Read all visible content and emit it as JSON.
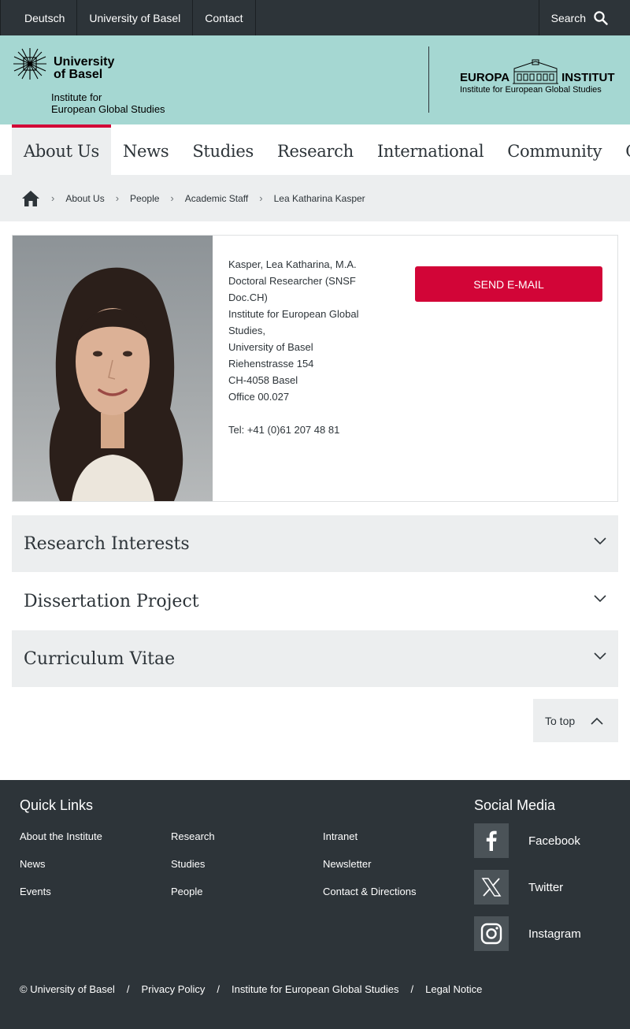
{
  "topbar": {
    "links": [
      "Deutsch",
      "University of Basel",
      "Contact"
    ],
    "search_label": "Search"
  },
  "header": {
    "uni_line1": "University",
    "uni_line2": "of Basel",
    "institute_line1": "Institute for",
    "institute_line2": "European Global Studies",
    "europa_left": "EUROPA",
    "europa_right": "INSTITUT",
    "europa_sub": "Institute for European Global Studies"
  },
  "nav": {
    "items": [
      "About Us",
      "News",
      "Studies",
      "Research",
      "International",
      "Community",
      "Co"
    ],
    "active": "About Us"
  },
  "breadcrumb": [
    "About Us",
    "People",
    "Academic Staff",
    "Lea Katharina Kasper"
  ],
  "profile": {
    "lines": [
      "Kasper, Lea Katharina, M.A.",
      "Doctoral Researcher (SNSF Doc.CH)",
      "Institute for European Global Studies,",
      "University of Basel",
      "Riehenstrasse 154",
      "CH-4058 Basel",
      "Office 00.027"
    ],
    "tel": "Tel: +41 (0)61 207 48 81",
    "email_button": "SEND E-MAIL"
  },
  "accordions": [
    "Research Interests",
    "Dissertation Project",
    "Curriculum Vitae"
  ],
  "to_top": "To top",
  "footer": {
    "quick_links_title": "Quick Links",
    "col1": [
      "About the Institute",
      "News",
      "Events"
    ],
    "col2": [
      "Research",
      "Studies",
      "People"
    ],
    "col3": [
      "Intranet",
      "Newsletter",
      "Contact & Directions"
    ],
    "social_title": "Social Media",
    "social": [
      "Facebook",
      "Twitter",
      "Instagram"
    ],
    "legal": [
      "© University of Basel",
      "Privacy Policy",
      "Institute for European Global Studies",
      "Legal Notice"
    ],
    "legal_sep": "/"
  },
  "colors": {
    "dark": "#2d3439",
    "mint": "#a5d7d2",
    "accent_red": "#d20537",
    "light_grey": "#eceeef"
  }
}
